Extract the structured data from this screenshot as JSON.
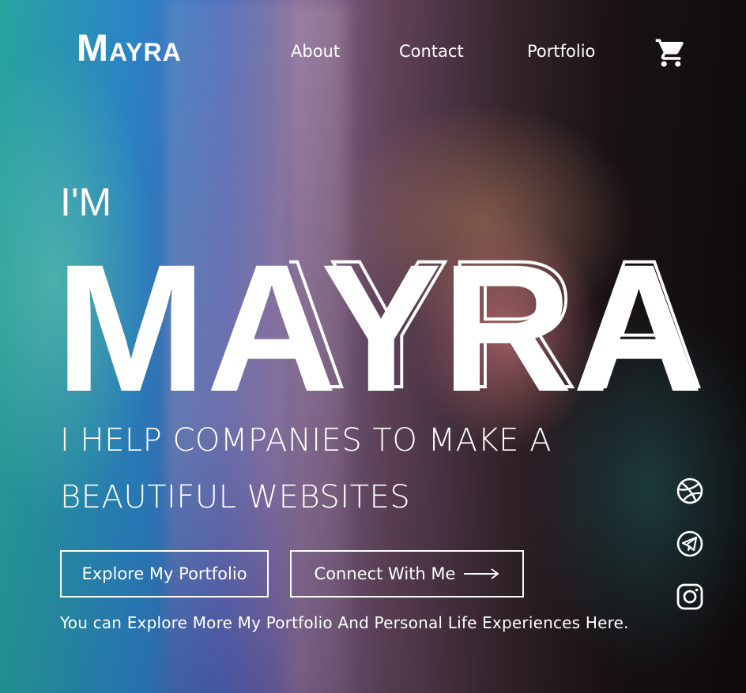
{
  "brand": {
    "initial": "M",
    "rest": "ayra"
  },
  "nav": {
    "about": "About",
    "contact": "Contact",
    "portfolio": "Portfolio"
  },
  "hero": {
    "intro": "I'M",
    "name": "MAYRA",
    "tagline_line1": "I HELP COMPANIES TO MAKE A",
    "tagline_line2": "BEAUTIFUL WEBSITES",
    "note": "You can Explore More My Portfolio And Personal Life Experiences Here."
  },
  "buttons": {
    "explore": "Explore My Portfolio",
    "connect": "Connect With Me"
  },
  "icons": {
    "cart": "shopping-cart-icon",
    "arrow": "arrow-right-icon",
    "social": [
      "dribbble-icon",
      "telegram-icon",
      "instagram-icon"
    ]
  },
  "colors": {
    "text": "#ffffff"
  }
}
